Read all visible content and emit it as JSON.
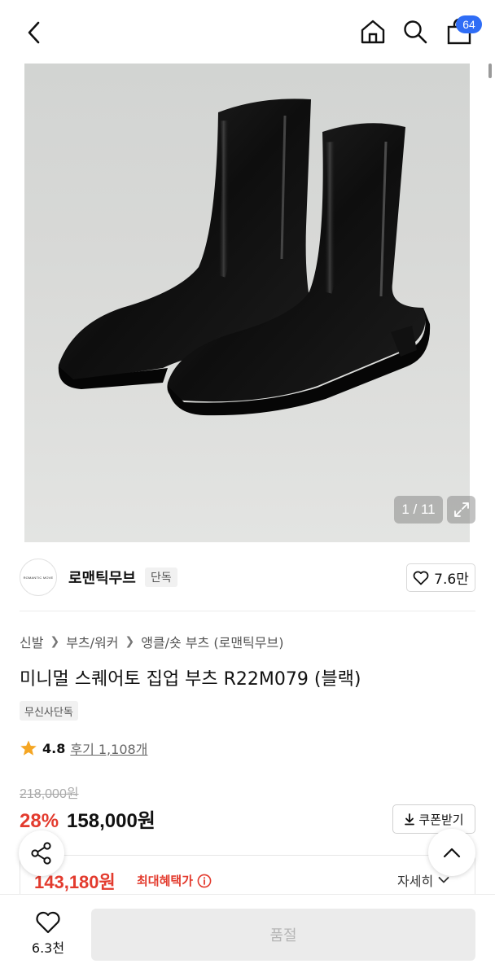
{
  "header": {
    "back_icon": "chevron-left-icon",
    "home_icon": "home-icon",
    "search_icon": "search-icon",
    "cart_icon": "shopping-bag-icon",
    "cart_count": "64"
  },
  "gallery": {
    "counter": "1 / 11",
    "expand_icon": "expand-icon"
  },
  "brand": {
    "logo_text": "ROMANTIC MOVE",
    "name": "로맨틱무브",
    "tag": "단독",
    "like_count": "7.6만"
  },
  "breadcrumb": [
    "신발",
    "부츠/워커",
    "앵클/숏 부츠 (로맨틱무브)"
  ],
  "product": {
    "title": "미니멀 스퀘어토 집업 부츠 R22M079 (블랙)",
    "exclusive_tag": "무신사단독",
    "rating": "4.8",
    "reviews": "후기 1,108개",
    "original_price": "218,000원",
    "discount": "28%",
    "price": "158,000원",
    "coupon_label": "쿠폰받기"
  },
  "benefit": {
    "price": "143,180원",
    "label": "최대혜택가",
    "detail": "자세히"
  },
  "bottom": {
    "wish_count": "6.3천",
    "soldout_label": "품절"
  },
  "colors": {
    "accent_red": "#e33b2e",
    "badge_blue": "#2f6df6",
    "star": "#f5a623"
  }
}
